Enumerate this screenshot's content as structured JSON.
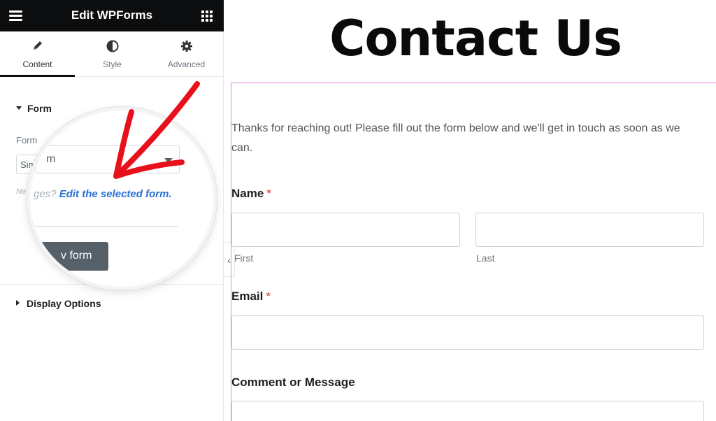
{
  "panel": {
    "header_title": "Edit WPForms",
    "tabs": [
      {
        "label": "Content",
        "icon": "pencil-icon",
        "active": true
      },
      {
        "label": "Style",
        "icon": "half-circle-icon",
        "active": false
      },
      {
        "label": "Advanced",
        "icon": "gear-icon",
        "active": false
      }
    ],
    "form_section": {
      "heading": "Form",
      "field_label": "Form",
      "select_value_partial": "Sim",
      "help_partial": "Nee"
    },
    "display_section": {
      "heading": "Display Options"
    }
  },
  "magnifier": {
    "select_value": "m",
    "help_prefix": "ges?",
    "help_link": "Edit the selected form.",
    "button_label": "v form"
  },
  "preview": {
    "title": "Contact Us",
    "intro": "Thanks for reaching out! Please fill out the form below and we'll get in touch as soon as we can.",
    "fields": {
      "name_label": "Name",
      "first_sublabel": "First",
      "last_sublabel": "Last",
      "email_label": "Email",
      "comment_label": "Comment or Message",
      "required_mark": "*"
    }
  },
  "colors": {
    "header_bg": "#0c0d0e",
    "link": "#2770d4",
    "arrow": "#e8101a",
    "required": "#d63637",
    "widget_outline": "#d98ae0"
  }
}
